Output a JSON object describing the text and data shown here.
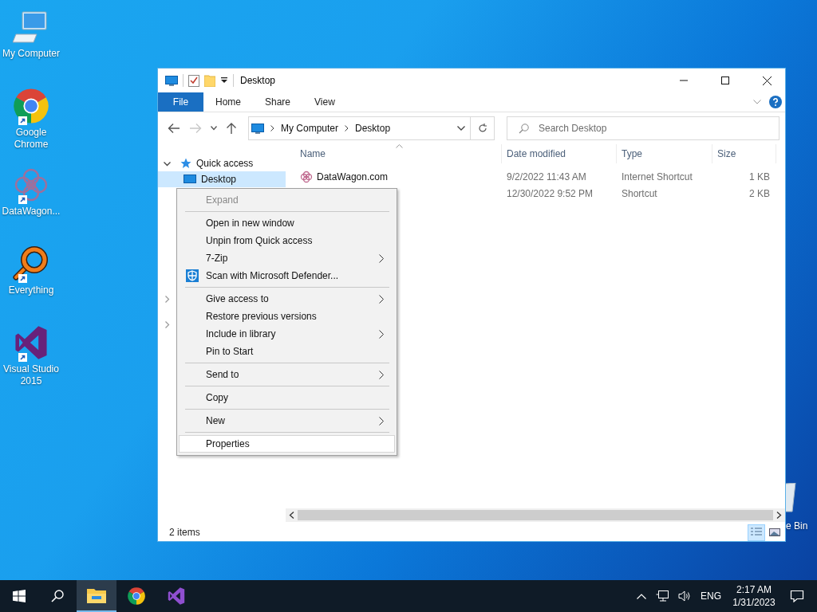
{
  "desktop_icons": [
    {
      "label": "My Computer",
      "kind": "computer",
      "shortcut": false
    },
    {
      "label": "Google Chrome",
      "kind": "chrome",
      "shortcut": true
    },
    {
      "label": "DataWagon...",
      "kind": "datawagon",
      "shortcut": true
    },
    {
      "label": "Everything",
      "kind": "everything",
      "shortcut": true
    },
    {
      "label": "Visual Studio 2015",
      "kind": "visualstudio",
      "shortcut": true
    }
  ],
  "recycle_bin": {
    "label": "e Bin"
  },
  "explorer": {
    "title": "Desktop",
    "ribbon_tabs": [
      {
        "label": "File",
        "kind": "file"
      },
      {
        "label": "Home",
        "kind": "tab"
      },
      {
        "label": "Share",
        "kind": "tab"
      },
      {
        "label": "View",
        "kind": "tab"
      }
    ],
    "nav_buttons": [
      {
        "kind": "back",
        "disabled": false
      },
      {
        "kind": "forward",
        "disabled": true
      },
      {
        "kind": "recent",
        "disabled": false
      },
      {
        "kind": "up",
        "disabled": false
      }
    ],
    "address": [
      "My Computer",
      "Desktop"
    ],
    "search": {
      "placeholder": "Search Desktop"
    },
    "tree": [
      {
        "label": "Quick access",
        "expanded": true,
        "selected": false,
        "children": [
          {
            "label": "Desktop",
            "selected": true
          }
        ]
      }
    ],
    "tree_collapsed": [
      {
        "expanded": false
      },
      {
        "expanded": false
      }
    ],
    "columns": [
      {
        "label": "Name",
        "sorted": true
      },
      {
        "label": "Date modified",
        "sorted": false
      },
      {
        "label": "Type",
        "sorted": false
      },
      {
        "label": "Size",
        "sorted": false
      }
    ],
    "rows": [
      {
        "name": "DataWagon.com",
        "date": "9/2/2022 11:43 AM",
        "type": "Internet Shortcut",
        "size": "1 KB"
      },
      {
        "date": "12/30/2022 9:52 PM",
        "type": "Shortcut",
        "size": "2 KB"
      }
    ],
    "status": "2 items",
    "view_buttons": [
      {
        "kind": "details",
        "selected": true
      },
      {
        "kind": "thumbnails",
        "selected": false
      }
    ]
  },
  "context_menu": [
    {
      "kind": "item",
      "label": "Expand",
      "disabled": true,
      "submenu": false,
      "highlighted": false
    },
    {
      "kind": "separator"
    },
    {
      "kind": "item",
      "label": "Open in new window",
      "disabled": false,
      "submenu": false,
      "highlighted": false
    },
    {
      "kind": "item",
      "label": "Unpin from Quick access",
      "disabled": false,
      "submenu": false,
      "highlighted": false
    },
    {
      "kind": "item",
      "label": "7-Zip",
      "disabled": false,
      "submenu": true,
      "highlighted": false
    },
    {
      "kind": "icon_item",
      "label": "Scan with Microsoft Defender...",
      "disabled": false,
      "submenu": false,
      "highlighted": false
    },
    {
      "kind": "separator"
    },
    {
      "kind": "item",
      "label": "Give access to",
      "disabled": false,
      "submenu": true,
      "highlighted": false
    },
    {
      "kind": "item",
      "label": "Restore previous versions",
      "disabled": false,
      "submenu": false,
      "highlighted": false
    },
    {
      "kind": "item",
      "label": "Include in library",
      "disabled": false,
      "submenu": true,
      "highlighted": false
    },
    {
      "kind": "item",
      "label": "Pin to Start",
      "disabled": false,
      "submenu": false,
      "highlighted": false
    },
    {
      "kind": "separator"
    },
    {
      "kind": "item",
      "label": "Send to",
      "disabled": false,
      "submenu": true,
      "highlighted": false
    },
    {
      "kind": "separator"
    },
    {
      "kind": "item",
      "label": "Copy",
      "disabled": false,
      "submenu": false,
      "highlighted": false
    },
    {
      "kind": "separator"
    },
    {
      "kind": "item",
      "label": "New",
      "disabled": false,
      "submenu": true,
      "highlighted": false
    },
    {
      "kind": "separator"
    },
    {
      "kind": "item",
      "label": "Properties",
      "disabled": false,
      "submenu": false,
      "highlighted": true
    }
  ],
  "taskbar": {
    "apps": [
      {
        "kind": "explorer",
        "active": true
      },
      {
        "kind": "chrome",
        "active": false
      },
      {
        "kind": "visualstudio",
        "active": false
      }
    ],
    "language": "ENG",
    "time": "2:17 AM",
    "date": "1/31/2023"
  }
}
